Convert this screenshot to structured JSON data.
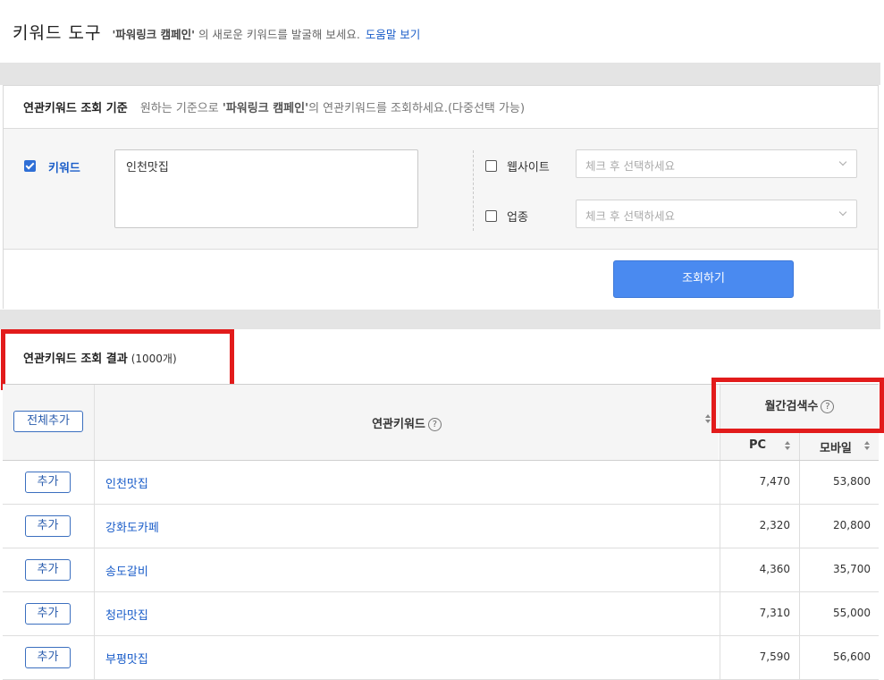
{
  "header": {
    "title": "키워드 도구",
    "sub_prefix": "'파워링크 캠페인'",
    "sub_suffix": "의 새로운 키워드를 발굴해 보세요.",
    "help_link": "도움말 보기"
  },
  "criteria": {
    "title": "연관키워드 조회 기준",
    "desc_prefix": "원하는 기준으로",
    "desc_campaign": "'파워링크 캠페인'",
    "desc_suffix": "의 연관키워드를 조회하세요.(다중선택 가능)",
    "keyword_label": "키워드",
    "keyword_value": "인천맛집",
    "website_label": "웹사이트",
    "website_placeholder": "체크 후 선택하세요",
    "industry_label": "업종",
    "industry_placeholder": "체크 후 선택하세요",
    "search_button": "조회하기"
  },
  "results": {
    "title": "연관키워드 조회 결과",
    "count": "(1000개)",
    "add_all": "전체추가",
    "col_keyword": "연관키워드",
    "col_monthly": "월간검색수",
    "col_pc": "PC",
    "col_mobile": "모바일",
    "add_label": "추가",
    "rows": [
      {
        "keyword": "인천맛집",
        "pc": "7,470",
        "mobile": "53,800"
      },
      {
        "keyword": "강화도카페",
        "pc": "2,320",
        "mobile": "20,800"
      },
      {
        "keyword": "송도갈비",
        "pc": "4,360",
        "mobile": "35,700"
      },
      {
        "keyword": "청라맛집",
        "pc": "7,310",
        "mobile": "55,000"
      },
      {
        "keyword": "부평맛집",
        "pc": "7,590",
        "mobile": "56,600"
      }
    ]
  },
  "icons": {
    "help": "?"
  },
  "colors": {
    "accent": "#4a8af0",
    "link": "#1a5dc9",
    "highlight": "#e21b1b"
  }
}
